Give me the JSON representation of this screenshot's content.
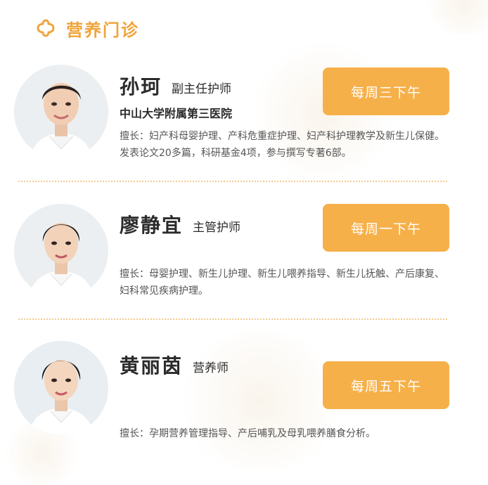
{
  "section": {
    "title": "营养门诊",
    "icon": "flower-icon"
  },
  "colors": {
    "accent": "#f6b049",
    "title": "#f0a43a",
    "divider": "#f3c98e"
  },
  "doctors": [
    {
      "name": "孙珂",
      "title": "副主任护师",
      "hospital": "中山大学附属第三医院",
      "description": "擅长：妇产科母婴护理、产科危重症护理、妇产科护理教学及新生儿保健。发表论文20多篇，科研基金4项，参与撰写专著6部。",
      "schedule": "每周三下午"
    },
    {
      "name": "廖静宜",
      "title": "主管护师",
      "description": "擅长：母婴护理、新生儿护理、新生儿喂养指导、新生儿抚触、产后康复、妇科常见疾病护理。",
      "schedule": "每周一下午"
    },
    {
      "name": "黄丽茵",
      "title": "营养师",
      "description": "擅长：孕期营养管理指导、产后哺乳及母乳喂养膳食分析。",
      "schedule": "每周五下午"
    }
  ]
}
